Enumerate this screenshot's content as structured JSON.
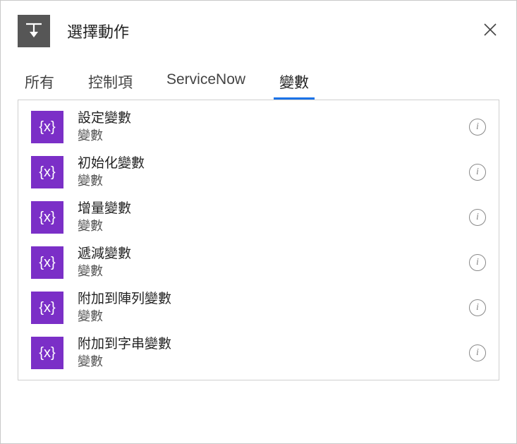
{
  "header": {
    "title": "選擇動作"
  },
  "tabs": [
    {
      "label": "所有",
      "active": false
    },
    {
      "label": "控制項",
      "active": false
    },
    {
      "label": "ServiceNow",
      "active": false
    },
    {
      "label": "變數",
      "active": true
    }
  ],
  "items": [
    {
      "title": "設定變數",
      "subtitle": "變數"
    },
    {
      "title": "初始化變數",
      "subtitle": "變數"
    },
    {
      "title": "增量變數",
      "subtitle": "變數"
    },
    {
      "title": "遞減變數",
      "subtitle": "變數"
    },
    {
      "title": "附加到陣列變數",
      "subtitle": "變數"
    },
    {
      "title": "附加到字串變數",
      "subtitle": "變數"
    }
  ],
  "icons": {
    "variable_glyph": "{x}",
    "info_glyph": "i"
  }
}
